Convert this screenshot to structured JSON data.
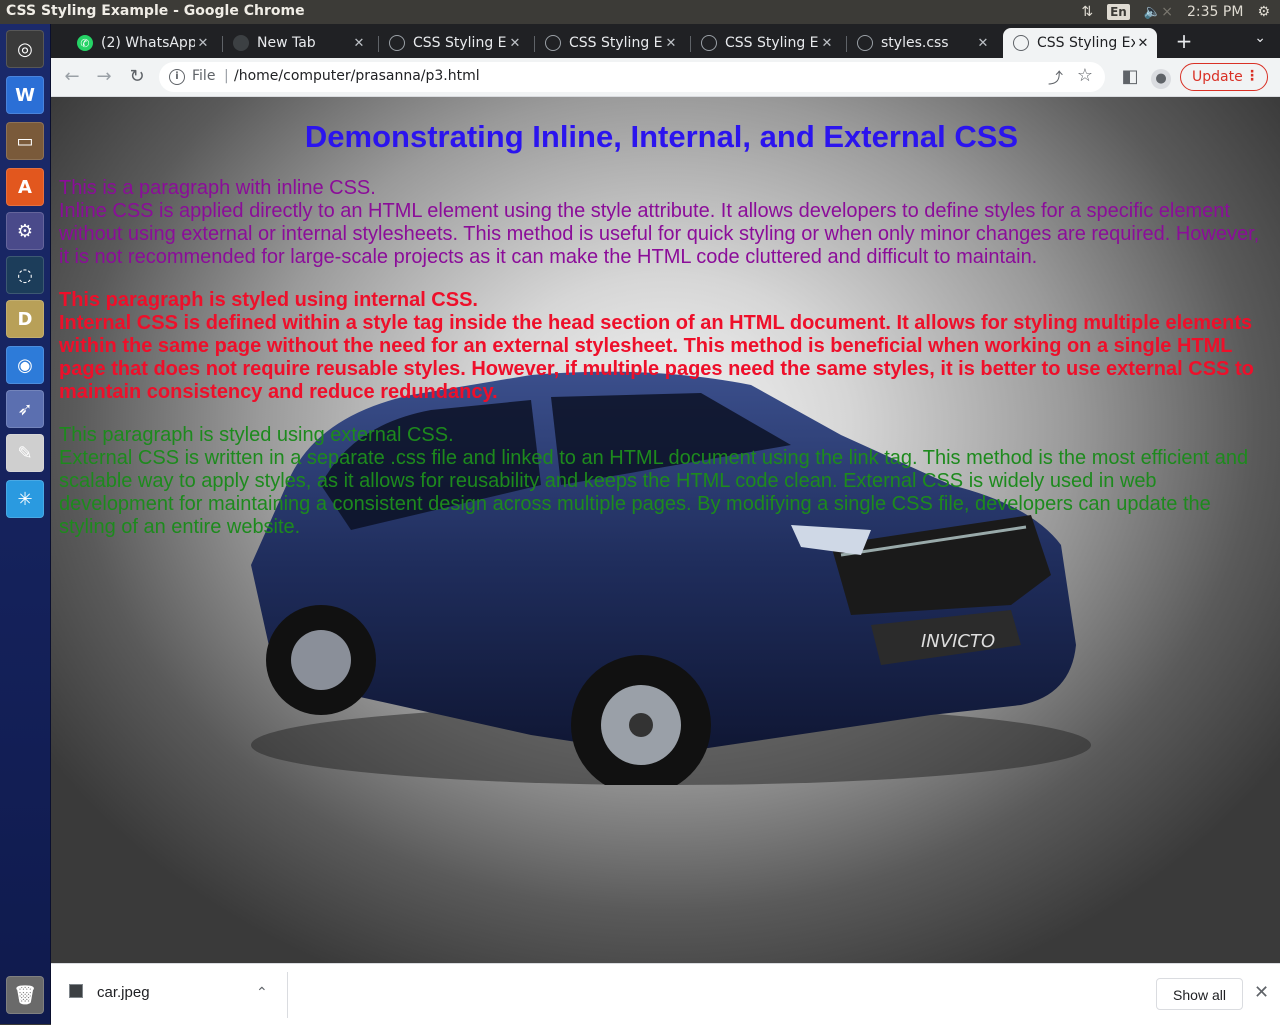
{
  "system": {
    "window_title": "CSS Styling Example - Google Chrome",
    "keyboard_layout": "En",
    "clock": "2:35 PM"
  },
  "launcher": {
    "items": [
      {
        "name": "dash-home-icon",
        "glyph": "◎",
        "color": "#3a3a3a"
      },
      {
        "name": "wps-writer-icon",
        "glyph": "W",
        "color": "#2b6fd6"
      },
      {
        "name": "files-icon",
        "glyph": "▭",
        "color": "#7a5a3a"
      },
      {
        "name": "software-center-icon",
        "glyph": "A",
        "color": "#e2571e"
      },
      {
        "name": "system-settings-icon",
        "glyph": "⚙",
        "color": "#4a4a8a"
      },
      {
        "name": "sync-app-icon",
        "glyph": "◌",
        "color": "#1c3d5a"
      },
      {
        "name": "dosbox-icon",
        "glyph": "D",
        "color": "#b8a058"
      },
      {
        "name": "chrome-icon",
        "glyph": "◉",
        "color": "#2d7bd9"
      },
      {
        "name": "bird-app-icon",
        "glyph": "➶",
        "color": "#5b6fb0"
      },
      {
        "name": "text-editor-icon",
        "glyph": "✎",
        "color": "#cfcfcf"
      },
      {
        "name": "blue-app-icon",
        "glyph": "✳",
        "color": "#2a9ae0"
      },
      {
        "name": "trash-icon",
        "glyph": "🗑",
        "color": "#6a6a6a"
      }
    ]
  },
  "tabs": [
    {
      "label": "(2) WhatsApp",
      "icon": "whatsapp-icon"
    },
    {
      "label": "New Tab",
      "icon": "new-tab-icon"
    },
    {
      "label": "CSS Styling Ex",
      "icon": "globe-icon"
    },
    {
      "label": "CSS Styling Ex",
      "icon": "globe-icon"
    },
    {
      "label": "CSS Styling Ex",
      "icon": "globe-icon"
    },
    {
      "label": "styles.css",
      "icon": "globe-icon"
    },
    {
      "label": "CSS Styling Ex",
      "icon": "globe-icon",
      "active": true
    }
  ],
  "toolbar": {
    "scheme": "File",
    "url": "/home/computer/prasanna/p3.html",
    "update_label": "Update"
  },
  "page": {
    "heading": "Demonstrating Inline, Internal, and External CSS",
    "inline": {
      "line1": "This is a paragraph with inline CSS.",
      "body": "Inline CSS is applied directly to an HTML element using the style attribute. It allows developers to define styles for a specific element without using external or internal stylesheets. This method is useful for quick styling or when only minor changes are required. However, it is not recommended for large-scale projects as it can make the HTML code cluttered and difficult to maintain."
    },
    "internal": {
      "line1": "This paragraph is styled using internal CSS.",
      "body": "Internal CSS is defined within a style tag inside the head section of an HTML document. It allows for styling multiple elements within the same page without the need for an external stylesheet. This method is beneficial when working on a single HTML page that does not require reusable styles. However, if multiple pages need the same styles, it is better to use external CSS to maintain consistency and reduce redundancy."
    },
    "external": {
      "line1": "This paragraph is styled using external CSS.",
      "body": "External CSS is written in a separate .css file and linked to an HTML document using the link tag. This method is the most efficient and scalable way to apply styles, as it allows for reusability and keeps the HTML code clean. External CSS is widely used in web development for maintaining a consistent design across multiple pages. By modifying a single CSS file, developers can update the styling of an entire website."
    },
    "car_badge_text": "INVICTO"
  },
  "downloads": {
    "file": "car.jpeg",
    "show_all": "Show all"
  },
  "colors": {
    "heading": "#2b14ee",
    "inline_text": "#8b0d99",
    "internal_text": "#ee0f2a",
    "external_text": "#1d8a1d"
  }
}
